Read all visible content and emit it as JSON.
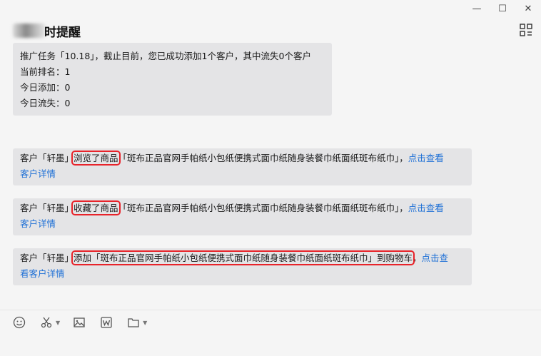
{
  "window": {
    "minimize": "—",
    "maximize": "☐",
    "close": "✕"
  },
  "header": {
    "title": "时提醒"
  },
  "top_message": {
    "line1": "推广任务「10.18」，截止目前，您已成功添加1个客户，其中流失0个客户",
    "line2": "当前排名：1",
    "line3": "今日添加：0",
    "line4": "今日流失：0"
  },
  "messages": [
    {
      "prefix": "客户「轩墨」",
      "highlight": "浏览了商品",
      "rest": "「斑布正品官网手帕纸小包纸便携式面巾纸随身装餐巾纸面纸斑布纸巾」，",
      "link1": "点击查看",
      "link2": "客户详情"
    },
    {
      "prefix": "客户「轩墨」",
      "highlight": "收藏了商品",
      "rest": "「斑布正品官网手帕纸小包纸便携式面巾纸随身装餐巾纸面纸斑布纸巾」，",
      "link1": "点击查看",
      "link2": "客户详情"
    },
    {
      "prefix": "客户「轩墨」",
      "highlight": "添加「斑布正品官网手帕纸小包纸便携式面巾纸随身装餐巾纸面纸斑布纸巾」到购物车",
      "rest": "，",
      "link1": "点击查",
      "link2": "看客户详情"
    }
  ],
  "toolbar": {
    "icons": [
      "emoji-icon",
      "scissors-icon",
      "image-icon",
      "word-icon",
      "folder-icon"
    ]
  }
}
